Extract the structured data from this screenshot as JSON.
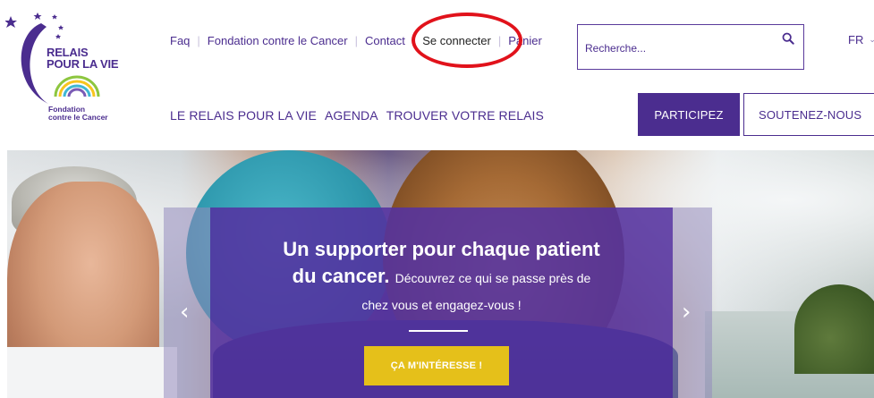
{
  "logo": {
    "title_line1": "RELAIS",
    "title_line2": "POUR LA VIE",
    "sub_line1": "Fondation",
    "sub_line2": "contre le Cancer"
  },
  "top_links": {
    "faq": "Faq",
    "fondation": "Fondation contre le Cancer",
    "contact": "Contact",
    "login": "Se connecter",
    "cart": "Panier",
    "separator": "|"
  },
  "search": {
    "placeholder": "Recherche..."
  },
  "language": {
    "current": "FR",
    "chevron": "⌄"
  },
  "main_nav": {
    "items": [
      "LE RELAIS POUR LA VIE",
      "AGENDA",
      "TROUVER VOTRE RELAIS"
    ]
  },
  "buttons": {
    "participez": "PARTICIPEZ",
    "soutenez": "SOUTENEZ-NOUS"
  },
  "hero": {
    "headline_line1": "Un supporter pour chaque patient",
    "headline_line2_bold": "du cancer.",
    "headline_line2_rest": "Découvrez ce qui se passe près de",
    "headline_line3": "chez vous et engagez-vous !",
    "cta": "ÇA M'INTÉRESSE !",
    "prev_arrow": "‹",
    "next_arrow": "›"
  },
  "colors": {
    "brand_purple": "#4b2d8f",
    "cta_yellow": "#e5c01a",
    "highlight_red": "#e1121b"
  },
  "icons": {
    "search": "search-icon",
    "chevron": "chevron-down-icon",
    "star": "star-icon",
    "rainbow": "rainbow-icon"
  }
}
